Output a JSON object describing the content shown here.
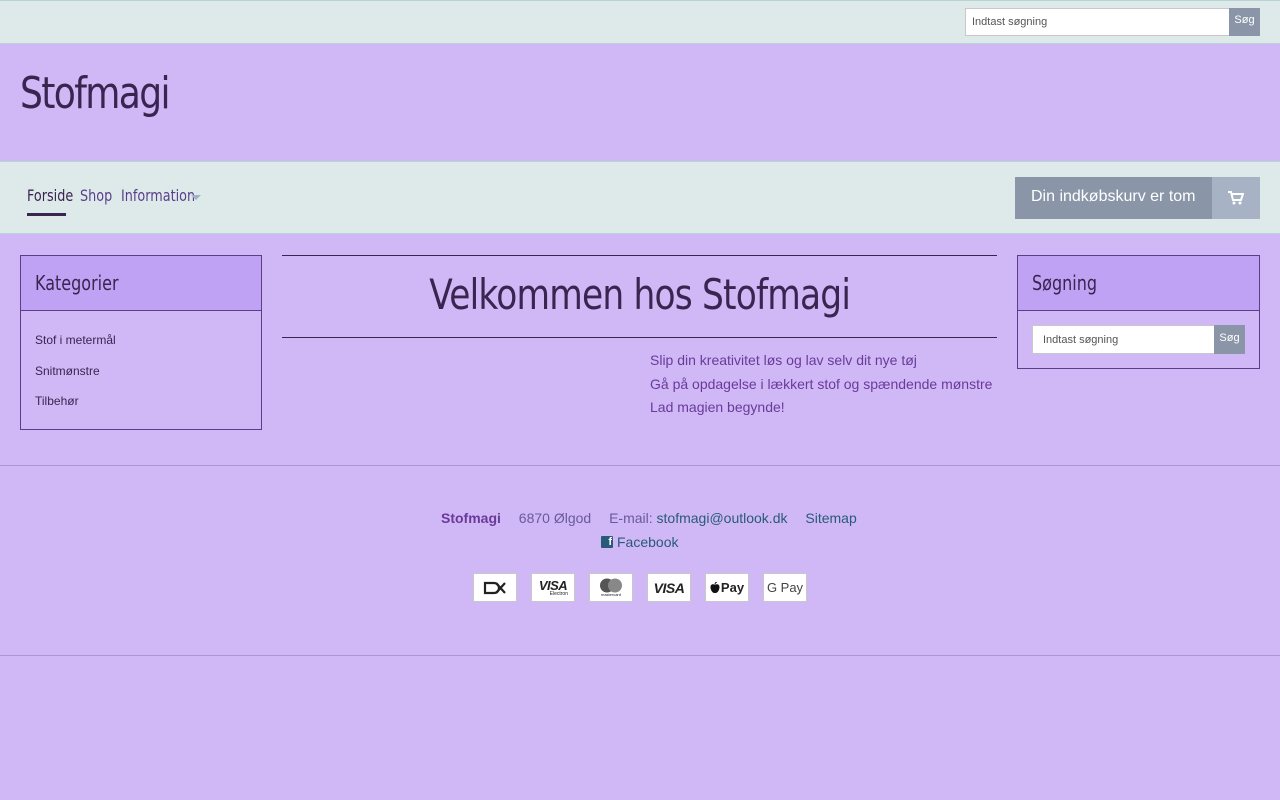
{
  "top_search": {
    "placeholder": "Indtast søgning",
    "button": "Søg"
  },
  "site": {
    "logo": "Stofmagi"
  },
  "nav": {
    "items": [
      "Forside",
      "Shop",
      "Information"
    ],
    "active": "Forside"
  },
  "cart": {
    "label": "Din indkøbskurv er tom",
    "icon": "shopping-cart-icon"
  },
  "categories": {
    "title": "Kategorier",
    "items": [
      "Stof i metermål",
      "Snitmønstre",
      "Tilbehør"
    ]
  },
  "side_search": {
    "title": "Søgning",
    "placeholder": "Indtast søgning",
    "button": "Søg"
  },
  "main": {
    "title": "Velkommen hos Stofmagi",
    "lines": [
      "Slip din kreativitet løs og lav selv dit nye tøj",
      "Gå på opdagelse i lækkert stof og spændende mønstre",
      "Lad magien begynde!"
    ]
  },
  "footer": {
    "brand": "Stofmagi",
    "address": "6870 Ølgod",
    "email_label": "E-mail:",
    "email": "stofmagi@outlook.dk",
    "sitemap": "Sitemap",
    "facebook": "Facebook",
    "payment_methods": [
      "Dankort",
      "Visa Electron",
      "Mastercard",
      "Visa",
      "Apple Pay",
      "Google Pay"
    ],
    "payment_labels": {
      "visa_electron": "VISA",
      "visa_electron_sub": "Electron",
      "mastercard_sub": "mastercard",
      "visa": "VISA",
      "applepay": "Pay",
      "googlepay": "G Pay"
    }
  },
  "colors": {
    "page_bg": "#cfb8f5",
    "bar_bg": "#deeaea",
    "box_head_bg": "#c0a2f5",
    "button_grey": "#8a96a8",
    "text_dark": "#3a2450",
    "text_purple": "#6a3a9a"
  }
}
